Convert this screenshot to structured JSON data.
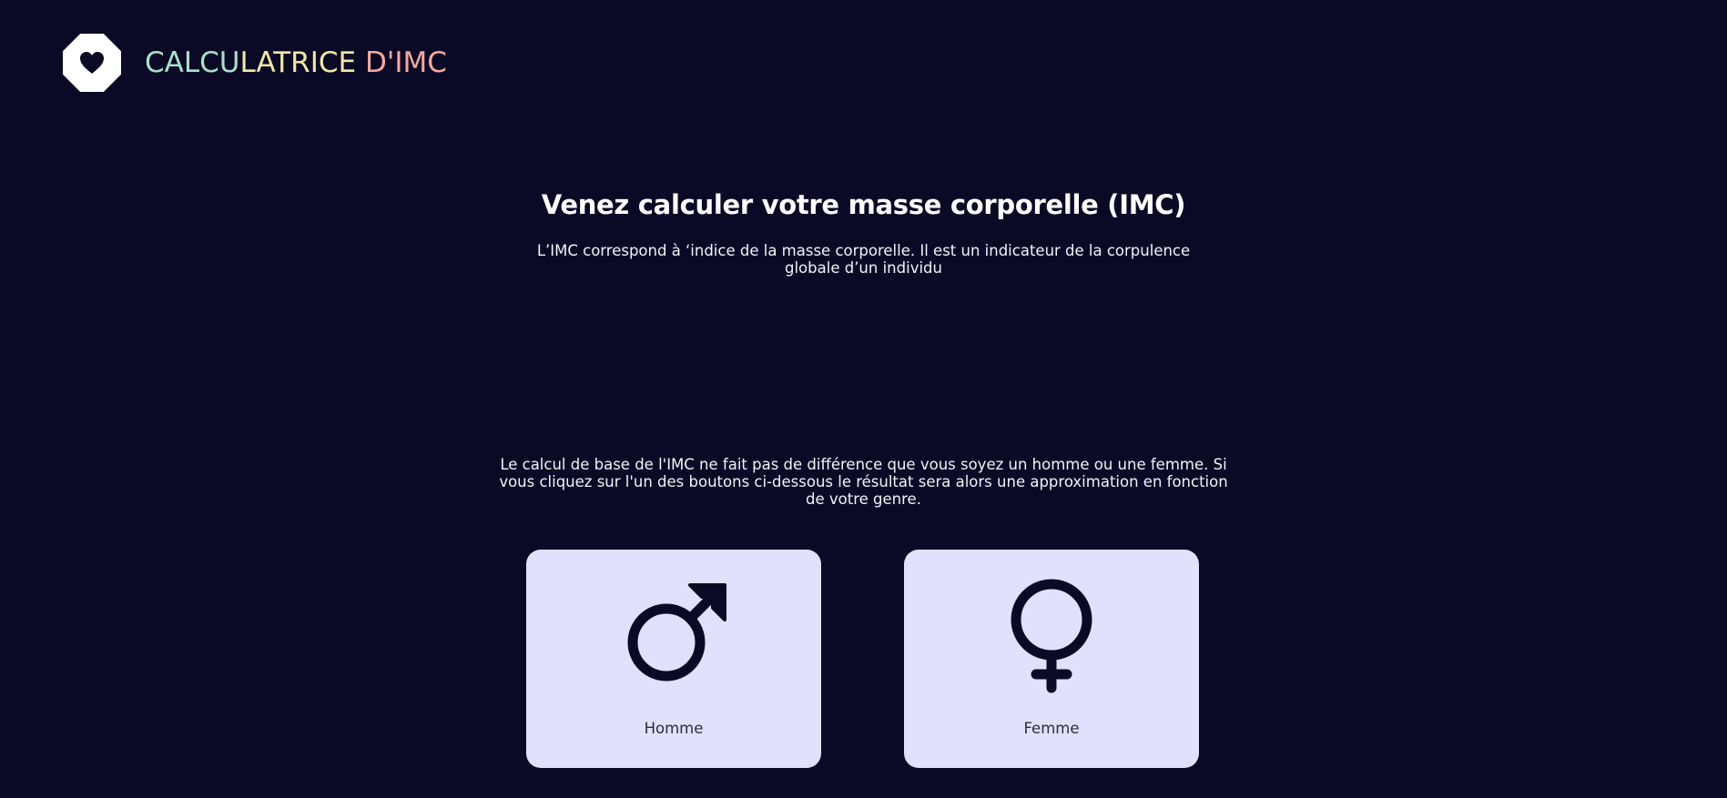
{
  "header": {
    "logo_icon": "heart-icon",
    "brand_part1": "CALCU",
    "brand_part2": "LATRICE",
    "brand_part3": "D'IMC",
    "colors": {
      "part1": "#a6e2c9",
      "part2": "#f1e7a4",
      "part3": "#f5a99b"
    }
  },
  "hero": {
    "title": "Venez calculer votre masse corporelle (IMC)",
    "description": "L’IMC correspond à ‘indice de la masse corporelle. Il est un indicateur de la corpulence globale d’un individu"
  },
  "note": {
    "text": "Le calcul de base de l'IMC ne fait pas de différence que vous soyez un homme ou une femme. Si vous cliquez sur l'un des boutons ci-dessous le résultat sera alors une approximation en fonction de votre genre."
  },
  "genders": [
    {
      "label": "Homme",
      "icon": "male-symbol-icon"
    },
    {
      "label": "Femme",
      "icon": "female-symbol-icon"
    }
  ],
  "colors": {
    "background": "#0b0a26",
    "card_background": "#e1e0fd",
    "symbol": "#0b0a26"
  }
}
